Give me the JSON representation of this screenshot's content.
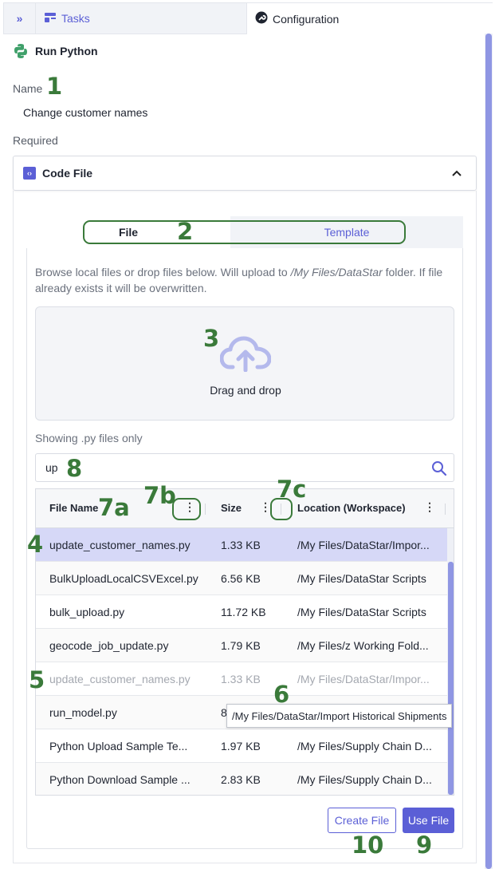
{
  "tabs": {
    "collapse": "»",
    "tasks": "Tasks",
    "configuration": "Configuration"
  },
  "task": {
    "title": "Run Python"
  },
  "name": {
    "label": "Name",
    "value": "Change customer names"
  },
  "required": {
    "label": "Required"
  },
  "accordion": {
    "title": "Code File"
  },
  "source_toggle": {
    "file": "File",
    "template": "Template"
  },
  "help_text": {
    "before": "Browse local files or drop files below. Will upload to ",
    "path": "/My Files/DataStar",
    "after": " folder. If file already exists it will be overwritten."
  },
  "dropzone": {
    "label": "Drag and drop"
  },
  "filter_note": "Showing .py files only",
  "search": {
    "value": "up"
  },
  "grid": {
    "columns": [
      "File Name",
      "Size",
      "Location (Workspace)"
    ],
    "rows": [
      {
        "name": "update_customer_names.py",
        "size": "1.33 KB",
        "location": "/My Files/DataStar/Impor..."
      },
      {
        "name": "BulkUploadLocalCSVExcel.py",
        "size": "6.56 KB",
        "location": "/My Files/DataStar Scripts"
      },
      {
        "name": "bulk_upload.py",
        "size": "11.72 KB",
        "location": "/My Files/DataStar Scripts"
      },
      {
        "name": "geocode_job_update.py",
        "size": "1.79 KB",
        "location": "/My Files/z Working Fold..."
      },
      {
        "name": "update_customer_names.py",
        "size": "1.33 KB",
        "location": "/My Files/DataStar/Impor..."
      },
      {
        "name": "run_model.py",
        "size": "8",
        "location": ""
      },
      {
        "name": "Python Upload Sample Te...",
        "size": "1.97 KB",
        "location": "/My Files/Supply Chain D..."
      },
      {
        "name": "Python Download Sample ...",
        "size": "2.83 KB",
        "location": "/My Files/Supply Chain D..."
      }
    ]
  },
  "tooltip": "/My Files/DataStar/Import Historical Shipments",
  "buttons": {
    "create": "Create File",
    "use": "Use File"
  },
  "callouts": {
    "n1": "1",
    "n2": "2",
    "n3": "3",
    "n4": "4",
    "n5": "5",
    "n6": "6",
    "n7a": "7a",
    "n7b": "7b",
    "n7c": "7c",
    "n8": "8",
    "n9": "9",
    "n10": "10"
  },
  "colors": {
    "accent": "#5b5fd6",
    "callout": "#3a7a3a",
    "selected_row": "#d6d8f7"
  }
}
